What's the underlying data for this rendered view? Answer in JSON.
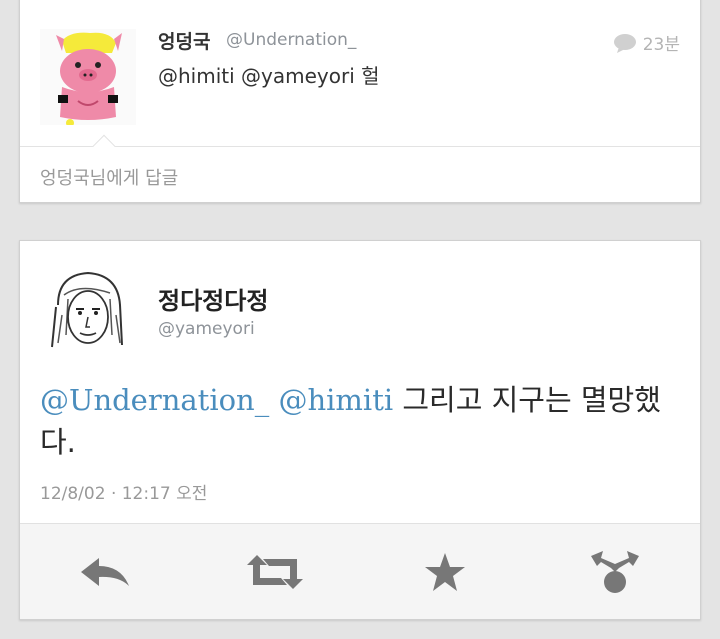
{
  "previous_tweet": {
    "name": "엉덩국",
    "handle": "@Undernation_",
    "time": "23분",
    "text": "@himiti @yameyori 헐",
    "reply_placeholder": "엉덩국님에게 답글"
  },
  "main_tweet": {
    "name": "정다정다정",
    "handle": "@yameyori",
    "mention_1": "@Undernation_",
    "mention_2": "@himiti",
    "text_rest": " 그리고 지구는 멸망했다.",
    "timestamp": "12/8/02 · 12:17 오전"
  },
  "actions": {
    "icons": [
      "reply-icon",
      "retweet-icon",
      "favorite-icon",
      "share-icon"
    ]
  },
  "colors": {
    "mention": "#4a8dbd",
    "icon_gray": "#777777",
    "background": "#e4e4e4"
  }
}
